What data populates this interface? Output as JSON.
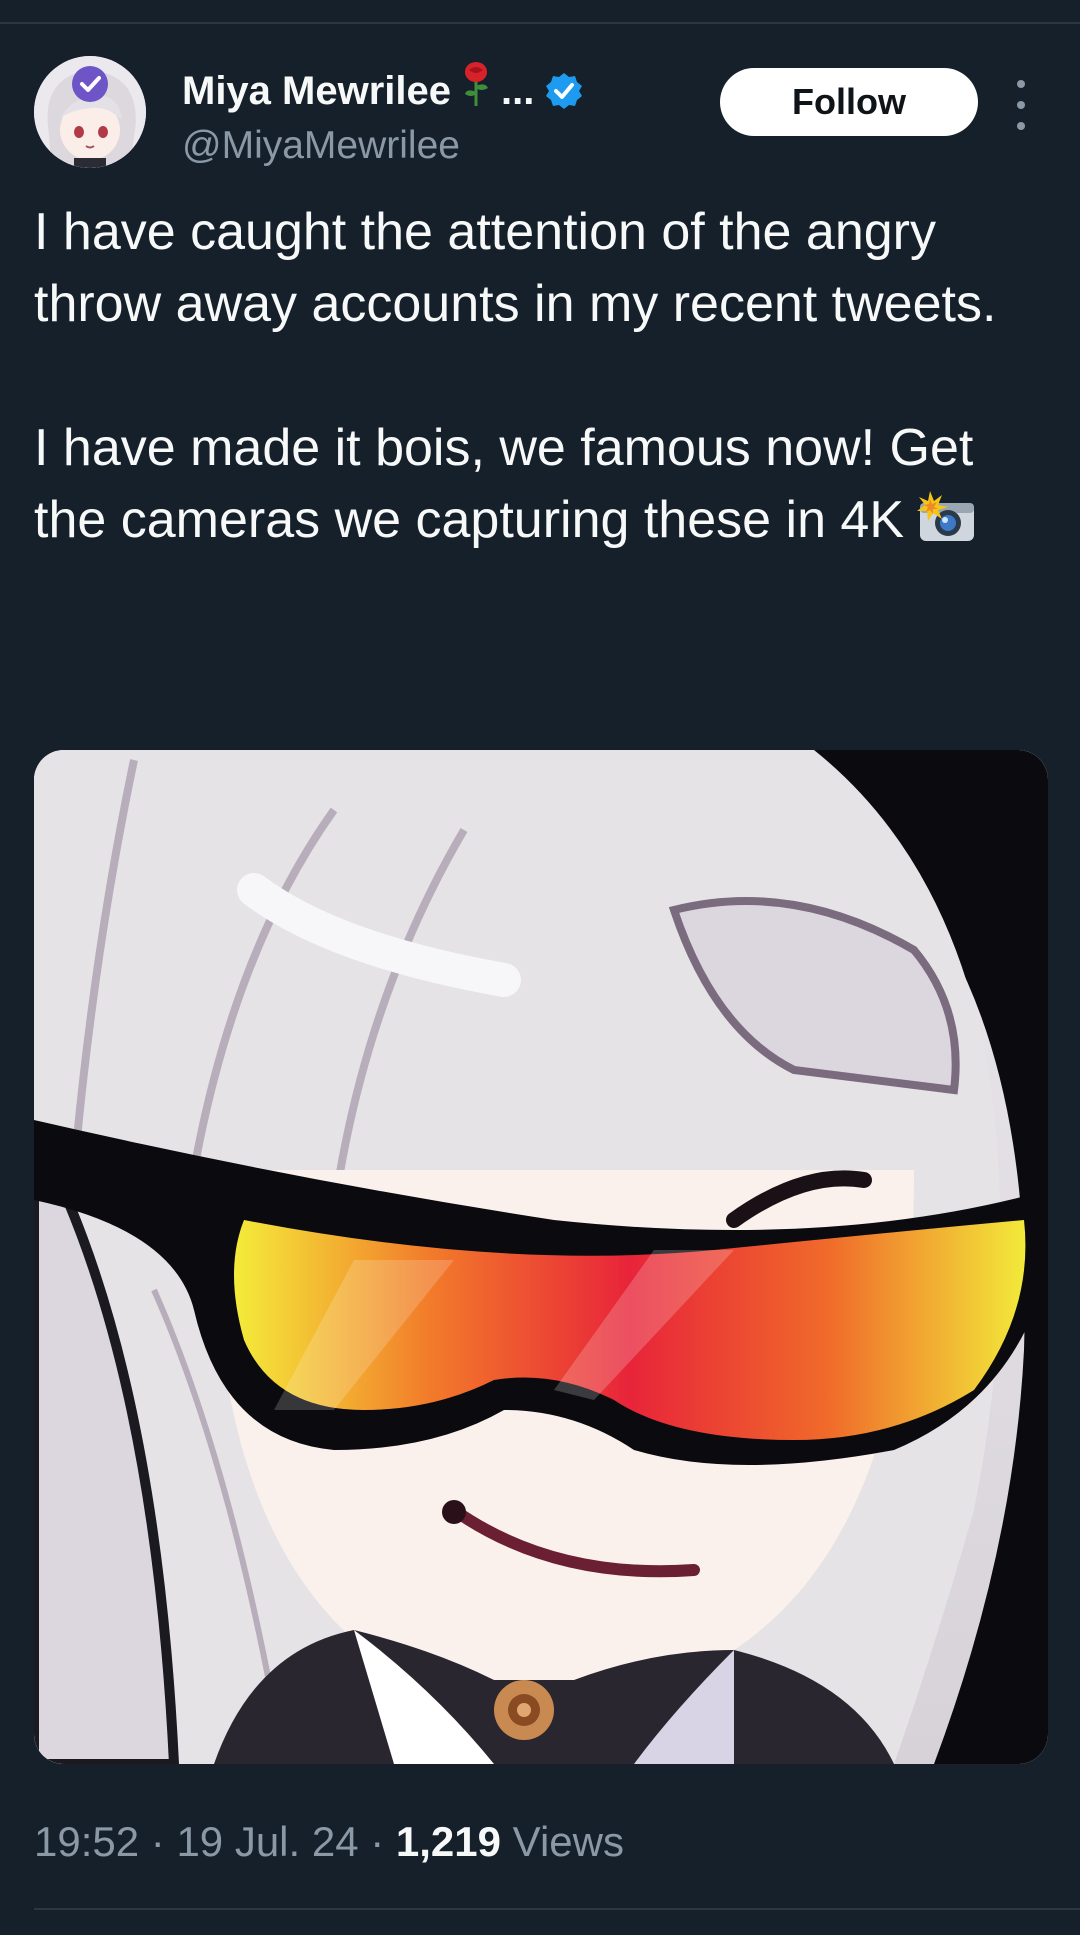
{
  "author": {
    "display_name": "Miya Mewrilee",
    "name_emoji": "rose-icon",
    "name_truncation": "...",
    "handle": "@MiyaMewrilee",
    "verified_icon": "verified-badge-icon",
    "verified_color": "#1d9bf0"
  },
  "actions": {
    "follow_label": "Follow",
    "more_icon": "more-vertical-icon"
  },
  "tweet": {
    "line1": "I have caught the attention of the angry throw away accounts in my recent tweets.",
    "line2": "I have made it bois, we famous now! Get the cameras we capturing these in 4K",
    "trailing_emoji": "camera-flash-icon",
    "media_description_icon": "anime-girl-sunglasses-image"
  },
  "meta": {
    "time": "19:52",
    "sep1": " · ",
    "date": "19 Jul. 24",
    "sep2": " · ",
    "views_count": "1,219",
    "views_label": " Views"
  },
  "colors": {
    "background": "#15202b",
    "text": "#f7f9f9",
    "secondary_text": "#8b98a5",
    "divider": "#2a3640"
  }
}
